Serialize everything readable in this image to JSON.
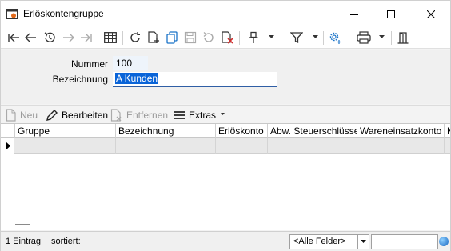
{
  "window": {
    "title": "Erlöskontengruppe"
  },
  "toolbar": {
    "icons": [
      "first-icon",
      "back-icon",
      "history-icon",
      "forward-icon",
      "last-icon",
      "table-icon",
      "refresh-icon",
      "new-doc-icon",
      "copy-icon",
      "save-icon",
      "undo-icon",
      "delete-icon",
      "pin-icon",
      "filter-icon",
      "settings-icon",
      "print-icon",
      "exit-icon"
    ]
  },
  "form": {
    "nummer_label": "Nummer",
    "nummer_value": "100",
    "bezeichnung_label": "Bezeichnung",
    "bezeichnung_value": "A Kunden"
  },
  "gridbar": {
    "neu": "Neu",
    "bearbeiten": "Bearbeiten",
    "entfernen": "Entfernen",
    "extras": "Extras"
  },
  "grid": {
    "columns": [
      "Gruppe",
      "Bezeichnung",
      "Erlöskonto",
      "Abw. Steuerschlüssel",
      "Wareneinsatzkonto",
      "K"
    ]
  },
  "status": {
    "count": "1 Eintrag",
    "sorted": "sortiert:",
    "filter_value": "<Alle Felder>"
  },
  "colors": {
    "selection": "#0a64d8",
    "accent": "#2f5ea5",
    "delete_red": "#d32f2f"
  }
}
